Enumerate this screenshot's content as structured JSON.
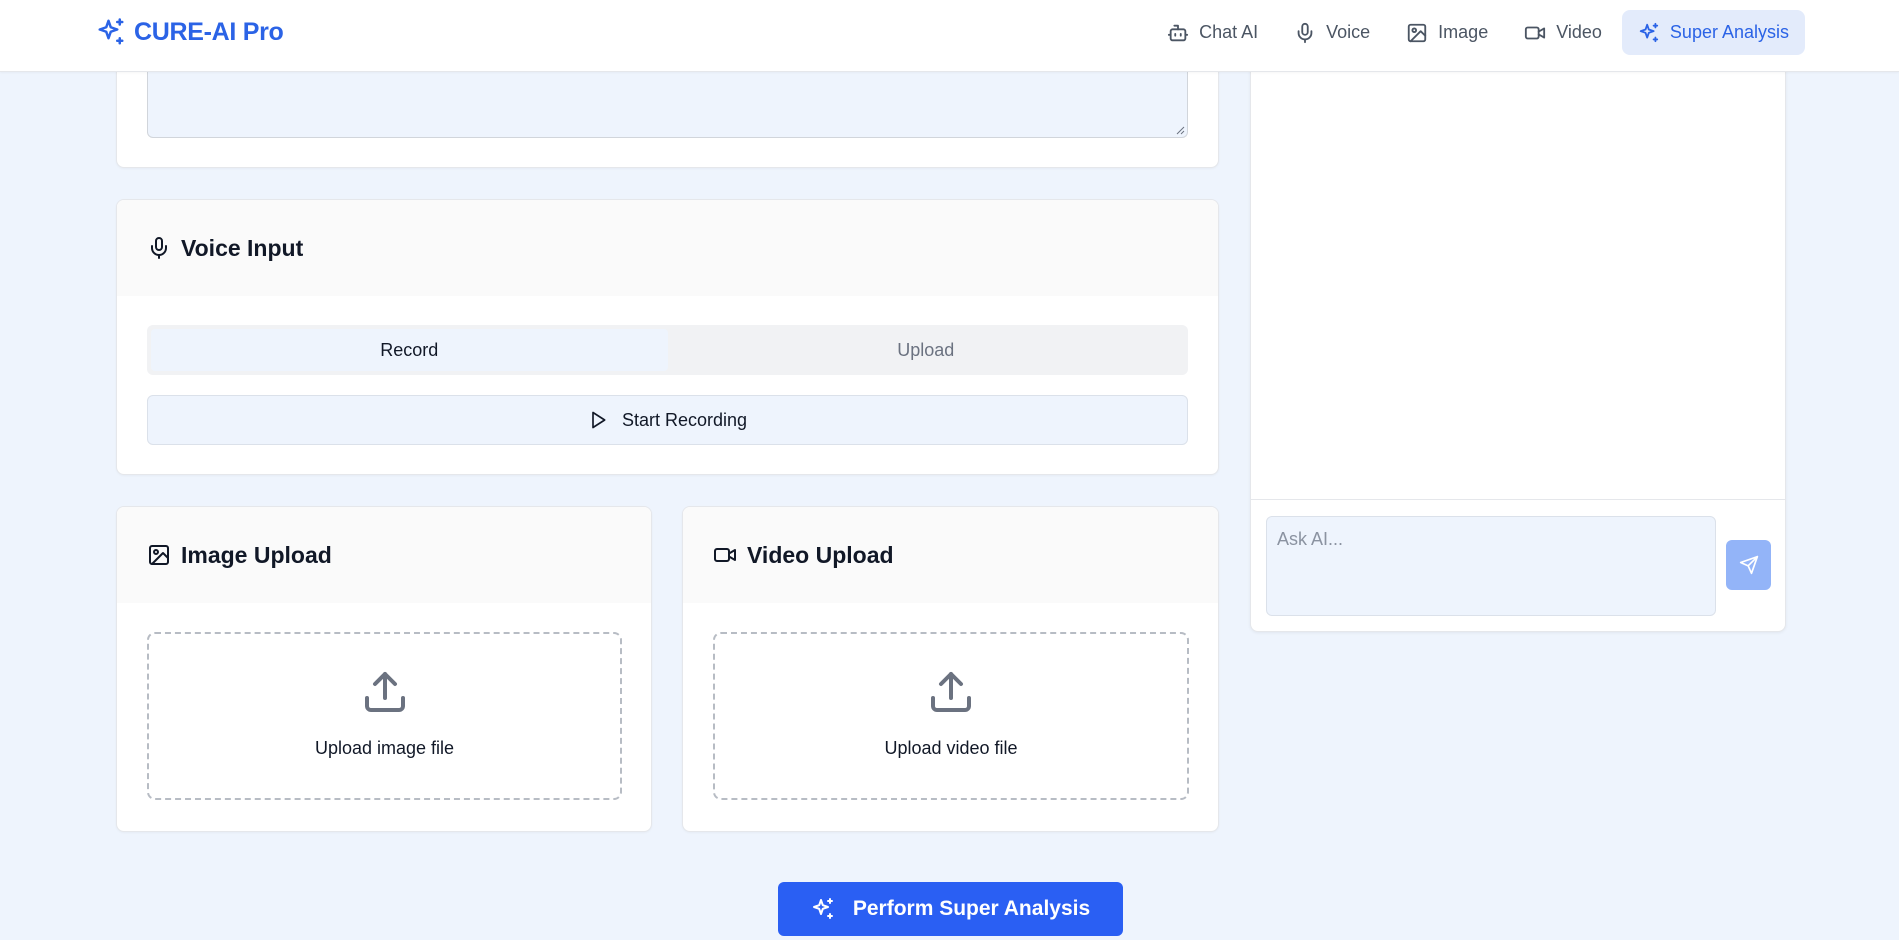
{
  "brand": {
    "name": "CURE-AI Pro",
    "icon": "sparkles-icon",
    "color": "#2b63e6"
  },
  "nav": {
    "items": [
      {
        "label": "Chat AI",
        "icon": "bot-icon",
        "active": false
      },
      {
        "label": "Voice",
        "icon": "mic-icon",
        "active": false
      },
      {
        "label": "Image",
        "icon": "image-icon",
        "active": false
      },
      {
        "label": "Video",
        "icon": "video-icon",
        "active": false
      },
      {
        "label": "Super Analysis",
        "icon": "sparkles-icon",
        "active": true
      }
    ]
  },
  "voice": {
    "title": "Voice Input",
    "tabs": [
      {
        "label": "Record",
        "active": true
      },
      {
        "label": "Upload",
        "active": false
      }
    ],
    "start_button": "Start Recording"
  },
  "image_upload": {
    "title": "Image Upload",
    "prompt": "Upload image file"
  },
  "video_upload": {
    "title": "Video Upload",
    "prompt": "Upload video file"
  },
  "chat": {
    "placeholder": "Ask AI...",
    "send_icon": "send-icon"
  },
  "action": {
    "label": "Perform Super Analysis",
    "color": "#2a5ff3"
  },
  "colors": {
    "page_bg": "#eef4fd",
    "accent": "#2b63e6",
    "active_nav_bg": "#e3ebfb",
    "send_bg": "#93b4f8"
  }
}
